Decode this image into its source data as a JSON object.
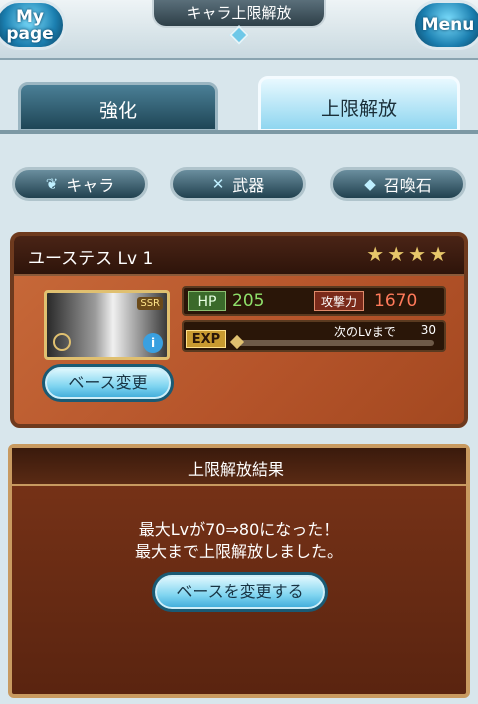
{
  "header": {
    "title": "キャラ上限解放",
    "mypage_label": "My page",
    "menu_label": "Menu"
  },
  "tabs": [
    {
      "label": "強化"
    },
    {
      "label": "上限解放"
    }
  ],
  "filters": [
    {
      "label": "キャラ",
      "icon": "wing-icon"
    },
    {
      "label": "武器",
      "icon": "crossed-swords-icon"
    },
    {
      "label": "召喚石",
      "icon": "crystal-icon"
    }
  ],
  "character": {
    "name_level": "ユーステス Lv 1",
    "stars": "★★★★",
    "rarity": "SSR",
    "hp_label": "HP",
    "hp": "205",
    "atk_label": "攻撃力",
    "atk": "1670",
    "exp_label": "EXP",
    "next_label": "次のLvまで",
    "next_value": "30",
    "exp_progress": 0,
    "base_change_label": "ベース変更"
  },
  "result": {
    "title": "上限解放結果",
    "line1": "最大Lvが70⇒80になった！",
    "line2": "最大まで上限解放しました。",
    "button_label": "ベースを変更する"
  }
}
